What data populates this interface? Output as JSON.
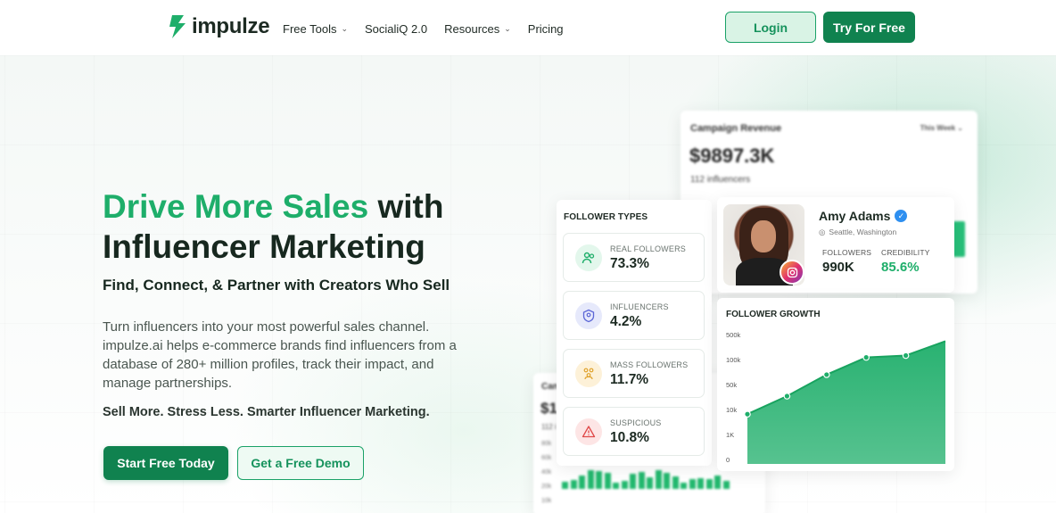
{
  "nav": {
    "logo_text": "impulze",
    "items": [
      {
        "label": "Free Tools",
        "has_dropdown": true
      },
      {
        "label": "SocialiQ 2.0",
        "has_dropdown": false
      },
      {
        "label": "Resources",
        "has_dropdown": true
      },
      {
        "label": "Pricing",
        "has_dropdown": false
      }
    ],
    "login_label": "Login",
    "try_label": "Try For Free"
  },
  "hero": {
    "headline_accent": "Drive More Sales",
    "headline_rest1": " with",
    "headline_line2": "Influencer Marketing",
    "subhead": "Find, Connect, & Partner with Creators Who Sell",
    "paragraph": "Turn influencers into your most powerful sales channel. impulze.ai helps e-commerce brands find influencers from a database of 280+ million profiles, track their impact, and manage partnerships.",
    "tagline": "Sell More. Stress Less. Smarter Influencer Marketing.",
    "start_label": "Start Free Today",
    "demo_label": "Get a Free Demo"
  },
  "revenue_card": {
    "title": "Campaign Revenue",
    "period": "This Week",
    "value": "$9897.3K",
    "sub": "112 influencers"
  },
  "small_card": {
    "title": "Can",
    "value": "$1",
    "sub": "112 i",
    "y_labels": [
      "80k",
      "60k",
      "40k",
      "20k",
      "10k"
    ],
    "bar_levels": [
      0.35,
      0.45,
      0.7,
      0.95,
      0.9,
      0.8,
      0.3,
      0.4,
      0.75,
      0.85,
      0.6,
      0.95,
      0.8,
      0.65,
      0.3,
      0.5,
      0.55,
      0.5,
      0.7,
      0.4
    ]
  },
  "follower_types": {
    "title": "FOLLOWER TYPES",
    "items": [
      {
        "label": "REAL FOLLOWERS",
        "value": "73.3%",
        "icon": "users-icon",
        "tint": "#e3f7ec",
        "color": "#1eae6a"
      },
      {
        "label": "INFLUENCERS",
        "value": "4.2%",
        "icon": "badge-icon",
        "tint": "#e6e9fb",
        "color": "#5b66d6"
      },
      {
        "label": "MASS FOLLOWERS",
        "value": "11.7%",
        "icon": "group-icon",
        "tint": "#fdf1d8",
        "color": "#e0a22c"
      },
      {
        "label": "SUSPICIOUS",
        "value": "10.8%",
        "icon": "warning-icon",
        "tint": "#fde5e5",
        "color": "#e04848"
      }
    ]
  },
  "profile": {
    "name": "Amy Adams",
    "location": "Seattle, Washington",
    "followers_label": "FOLLOWERS",
    "followers_value": "990K",
    "credibility_label": "CREDIBILITY",
    "credibility_value": "85.6%"
  },
  "growth": {
    "title": "FOLLOWER GROWTH",
    "y_labels": [
      "500k",
      "100k",
      "50k",
      "10k",
      "1K",
      "0"
    ],
    "accent": "#1eae6a"
  },
  "chart_data": {
    "type": "area",
    "title": "FOLLOWER GROWTH",
    "xlabel": "",
    "ylabel": "",
    "y_ticks": [
      "0",
      "1K",
      "10k",
      "50k",
      "100k",
      "500k"
    ],
    "x": [
      1,
      2,
      3,
      4,
      5,
      6
    ],
    "values": [
      8,
      30,
      68,
      120,
      150,
      380
    ]
  }
}
